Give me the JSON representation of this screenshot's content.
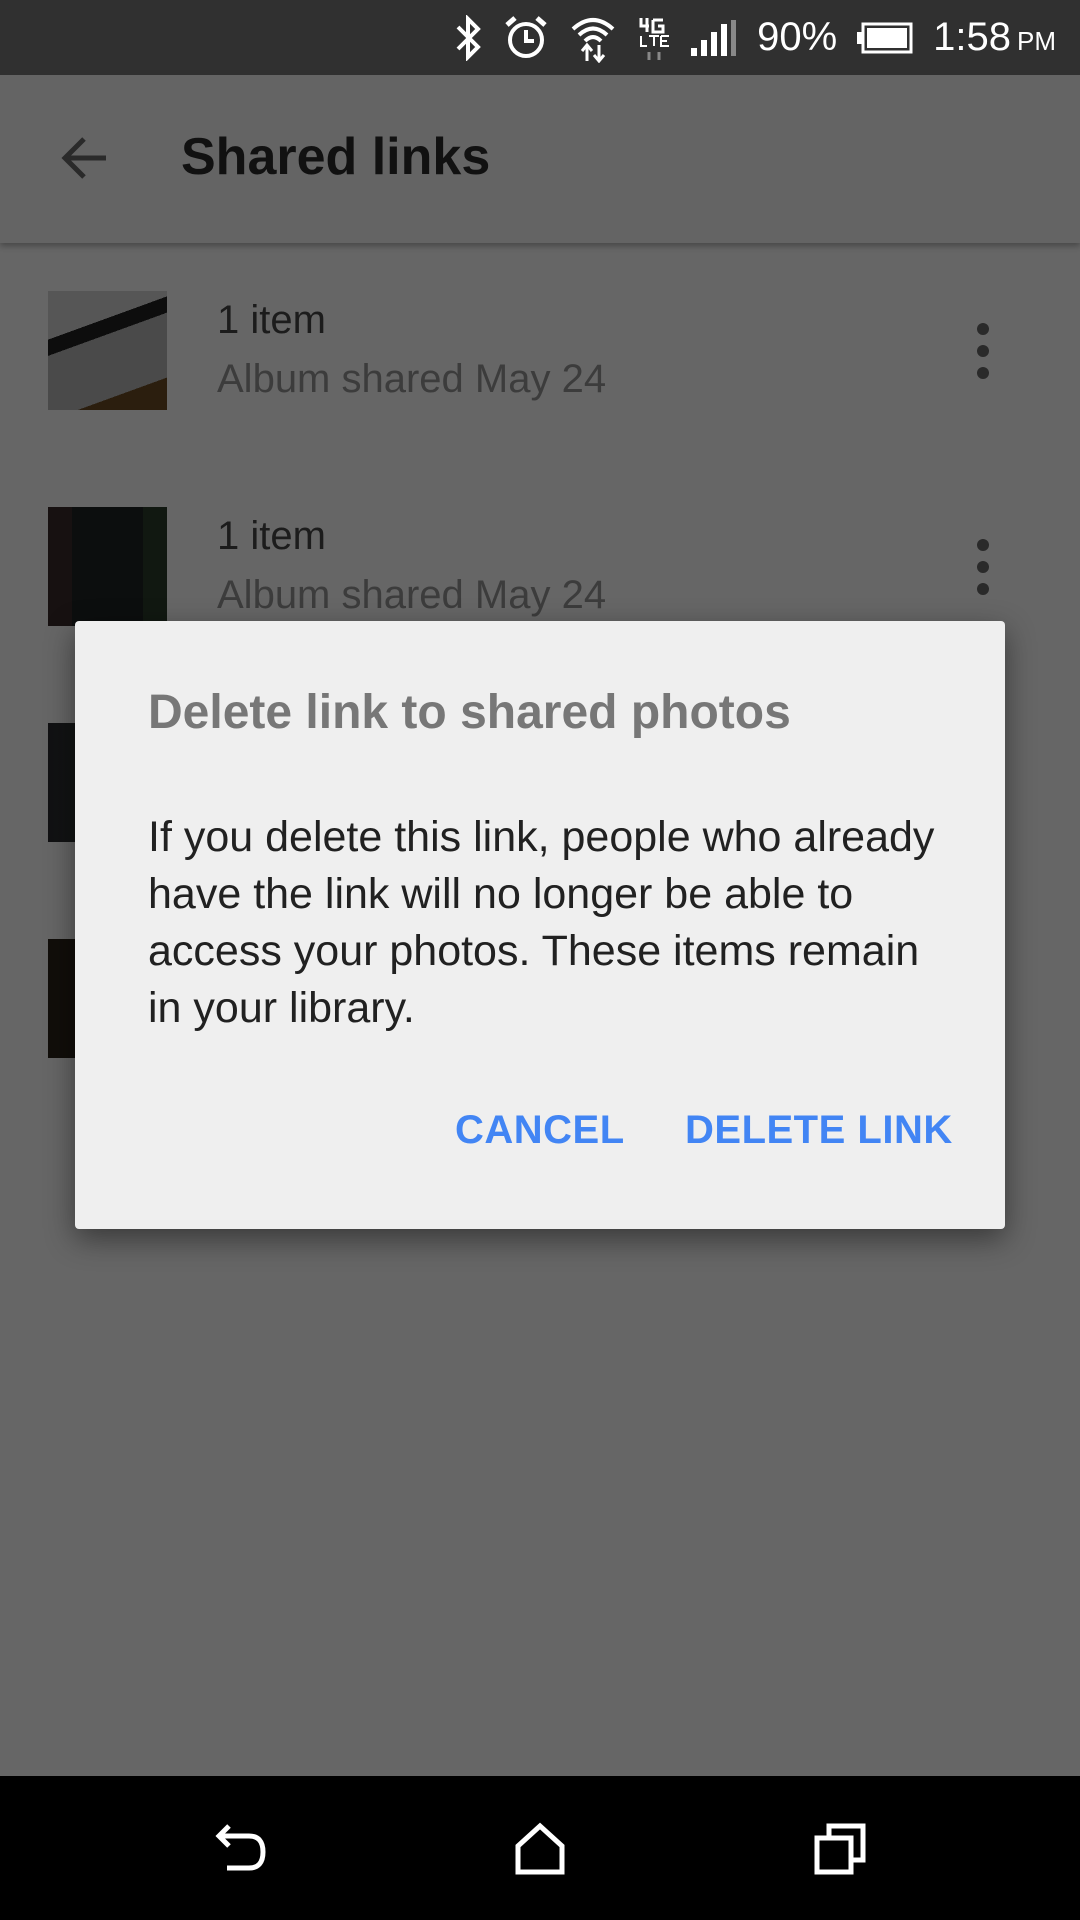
{
  "status_bar": {
    "icons": [
      "bluetooth-icon",
      "alarm-icon",
      "wifi-icon",
      "4g-lte-icon",
      "signal-icon",
      "battery-icon"
    ],
    "battery": "90%",
    "time": "1:58",
    "ampm": "PM"
  },
  "app_bar": {
    "title": "Shared links",
    "back_icon": "arrow-back-icon"
  },
  "list": {
    "items": [
      {
        "title": "1 item",
        "subtitle": "Album shared May 24"
      },
      {
        "title": "1 item",
        "subtitle": "Album shared May 24"
      },
      {
        "title": "",
        "subtitle": ""
      },
      {
        "title": "",
        "subtitle": ""
      }
    ]
  },
  "dialog": {
    "title": "Delete link to shared photos",
    "body": "If you delete this link, people who already have the link will no longer be able to access your photos. These items remain in your library.",
    "cancel_label": "CANCEL",
    "confirm_label": "DELETE LINK",
    "accent_color": "#4285f4"
  },
  "nav_bar": {
    "icons": [
      "back-icon",
      "home-icon",
      "recents-icon"
    ]
  }
}
